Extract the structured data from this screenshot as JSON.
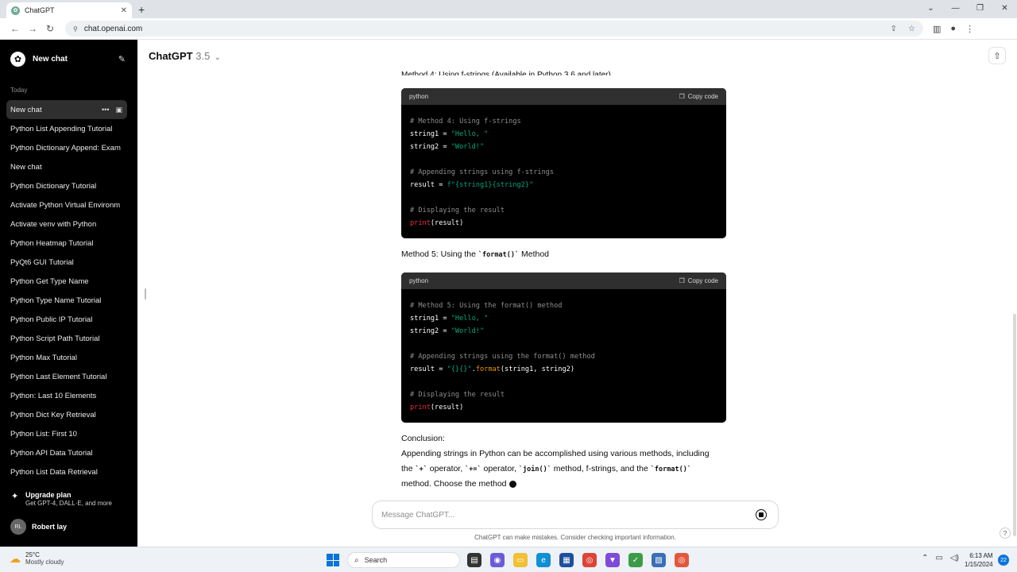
{
  "browser": {
    "tab_title": "ChatGPT",
    "url": "chat.openai.com"
  },
  "sidebar": {
    "new_chat_label": "New chat",
    "section_label": "Today",
    "chats": [
      {
        "label": "New chat",
        "active": true
      },
      {
        "label": "Python List Appending Tutorial"
      },
      {
        "label": "Python Dictionary Append: Exam"
      },
      {
        "label": "New chat"
      },
      {
        "label": "Python Dictionary Tutorial"
      },
      {
        "label": "Activate Python Virtual Environm"
      },
      {
        "label": "Activate venv with Python"
      },
      {
        "label": "Python Heatmap Tutorial"
      },
      {
        "label": "PyQt6 GUI Tutorial"
      },
      {
        "label": "Python Get Type Name"
      },
      {
        "label": "Python Type Name Tutorial"
      },
      {
        "label": "Python Public IP Tutorial"
      },
      {
        "label": "Python Script Path Tutorial"
      },
      {
        "label": "Python Max Tutorial"
      },
      {
        "label": "Python Last Element Tutorial"
      },
      {
        "label": "Python: Last 10 Elements"
      },
      {
        "label": "Python Dict Key Retrieval"
      },
      {
        "label": "Python List: First 10"
      },
      {
        "label": "Python API Data Tutorial"
      },
      {
        "label": "Python List Data Retrieval"
      }
    ],
    "upgrade_title": "Upgrade plan",
    "upgrade_subtitle": "Get GPT-4, DALL·E, and more",
    "user_initials": "RL",
    "user_name": "Robert lay"
  },
  "header": {
    "model_name": "ChatGPT",
    "model_version": "3.5"
  },
  "conversation": {
    "clipped_heading": "Method 4: Using f-strings (Available in Python 3.6 and later)",
    "code_blocks": [
      {
        "language": "python",
        "copy_label": "Copy code",
        "lines": [
          "# Method 4: Using f-strings",
          "string1 = \"Hello, \"",
          "string2 = \"World!\"",
          "",
          "# Appending strings using f-strings",
          "result = f\"{string1}{string2}\"",
          "",
          "# Displaying the result",
          "print(result)"
        ]
      },
      {
        "language": "python",
        "copy_label": "Copy code",
        "lines": [
          "# Method 5: Using the format() method",
          "string1 = \"Hello, \"",
          "string2 = \"World!\"",
          "",
          "# Appending strings using the format() method",
          "result = \"{}{}\".format(string1, string2)",
          "",
          "# Displaying the result",
          "print(result)"
        ]
      }
    ],
    "method5_prefix": "Method 5: Using the ",
    "method5_code": "`format()`",
    "method5_suffix": " Method",
    "conclusion_label": "Conclusion:",
    "conclusion_line1": "Appending strings in Python can be accomplished using various methods, including",
    "conclusion_l2_a": "the ",
    "conclusion_l2_code1": "`+`",
    "conclusion_l2_b": " operator, ",
    "conclusion_l2_code2": "`+=`",
    "conclusion_l2_c": " operator, ",
    "conclusion_l2_code3": "`join()`",
    "conclusion_l2_d": " method, f-strings, and the ",
    "conclusion_l2_code4": "`format()`",
    "conclusion_line3": "method. Choose the method"
  },
  "composer": {
    "placeholder": "Message ChatGPT...",
    "disclaimer": "ChatGPT can make mistakes. Consider checking important information."
  },
  "taskbar": {
    "temperature": "25°C",
    "weather": "Mostly cloudy",
    "search_label": "Search",
    "time": "6:13 AM",
    "date": "1/15/2024",
    "notification_count": "22"
  },
  "colors": {
    "sidebar_bg": "#000000",
    "code_bg": "#000000",
    "code_header": "#2f2f2f",
    "code_string": "#00a67d",
    "code_function": "#f22c3d",
    "code_comment": "#8e8e8e",
    "accent": "#0a74da"
  }
}
